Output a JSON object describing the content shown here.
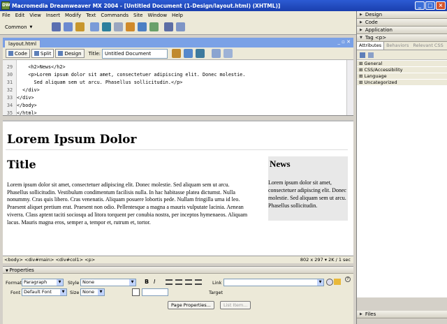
{
  "window": {
    "title": "Macromedia Dreamweaver MX 2004 - [Untitled Document (1-Design/layout.html) (XHTML)]"
  },
  "menu": [
    "File",
    "Edit",
    "View",
    "Insert",
    "Modify",
    "Text",
    "Commands",
    "Site",
    "Window",
    "Help"
  ],
  "insert_bar": {
    "category": "Common"
  },
  "document": {
    "tab": "layout.html",
    "views": [
      "Code",
      "Split",
      "Design"
    ],
    "title_label": "Title:",
    "title_value": "Untitled Document"
  },
  "code": [
    {
      "n": "29",
      "text": "    <h2>News</h2>"
    },
    {
      "n": "30",
      "text": "    <p>Lorem ipsum dolor sit amet, consectetuer adipiscing elit. Donec molestie."
    },
    {
      "n": "31",
      "text": "      Sed aliquam sem ut arcu. Phasellus sollicitudin.</p>"
    },
    {
      "n": "32",
      "text": "  </div>"
    },
    {
      "n": "33",
      "text": "</div>"
    },
    {
      "n": "34",
      "text": "</body>"
    },
    {
      "n": "35",
      "text": "</html>"
    }
  ],
  "design": {
    "heading": "Lorem Ipsum Dolor",
    "main_title": "Title",
    "main_text": "Lorem ipsum dolor sit amet, consectetuer adipiscing elit. Donec molestie. Sed aliquam sem ut arcu. Phasellus sollicitudin. Vestibulum condimentum facilisis nulla. In hac habitasse platea dictumst. Nulla nonummy. Cras quis libero. Cras venenatis. Aliquam posuere lobortis pede. Nullam fringilla urna id leo. Praesent aliquet pretium erat. Praesent non odio. Pellentesque a magna a mauris vulputate lacinia. Aenean viverra. Class aptent taciti sociosqu ad litora torquent per conubia nostra, per inceptos hymenaeos. Aliquam lacus. Mauris magna eros, semper a, tempor et, rutrum et, tortor.",
    "side_title": "News",
    "side_text": "Lorem ipsum dolor sit amet, consectetuer adipiscing elit. Donec molestie. Sed aliquam sem ut arcu. Phasellus sollicitudin."
  },
  "status": {
    "tags": "<body> <div#main> <div#col1> <p>",
    "size": "802 x 297",
    "download": "2K / 1 sec"
  },
  "properties": {
    "header": "Properties",
    "format_label": "Format",
    "format_value": "Paragraph",
    "style_label": "Style",
    "style_value": "None",
    "font_label": "Font",
    "font_value": "Default Font",
    "size_label": "Size",
    "size_value": "None",
    "link_label": "Link",
    "target_label": "Target",
    "page_props": "Page Properties...",
    "list_item": "List Item..."
  },
  "right_panels": {
    "groups": [
      "Design",
      "Code",
      "Application"
    ],
    "tag_title": "Tag <p>",
    "tabs": [
      "Attributes",
      "Behaviors",
      "Relevant CSS"
    ],
    "categories": [
      "General",
      "CSS/Accessibility",
      "Language",
      "Uncategorized"
    ],
    "files": "Files"
  }
}
